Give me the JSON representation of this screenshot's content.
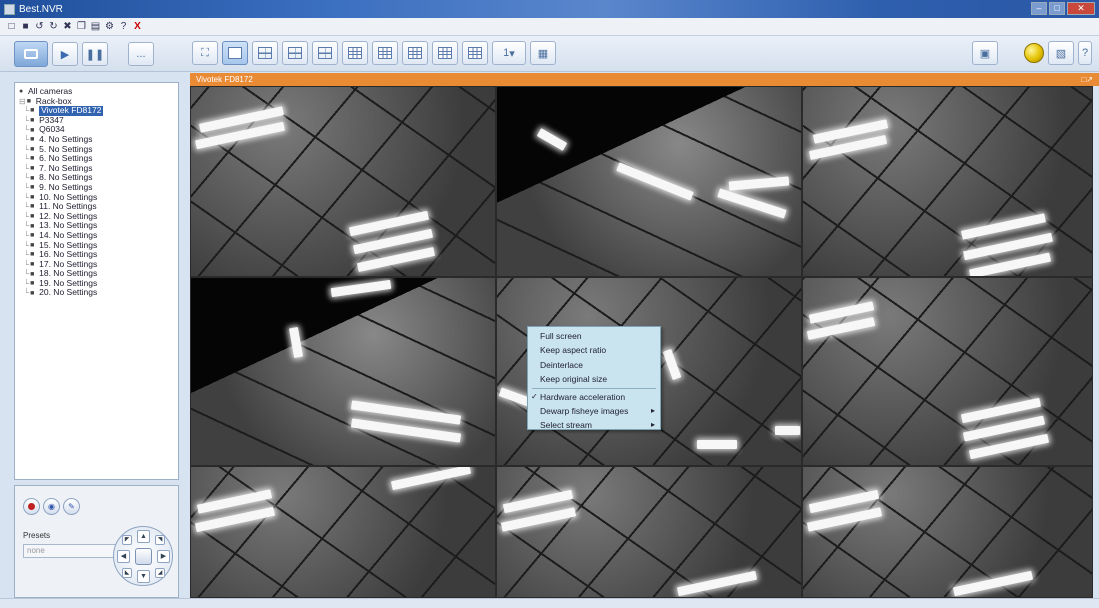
{
  "window": {
    "title": "Best.NVR"
  },
  "quickbar": {
    "icons": [
      "new-icon",
      "open-icon",
      "undo-icon",
      "redo-icon",
      "cut-icon",
      "copy-icon",
      "paste-icon",
      "settings-icon",
      "help-icon",
      "exit-icon"
    ],
    "exit_label": "X"
  },
  "toolbar": {
    "left_buttons": [
      "live-view-icon",
      "play-icon",
      "pause-icon"
    ],
    "dots_label": "...",
    "page_select": "1"
  },
  "tree": {
    "root": "All cameras",
    "group": "Rack-box",
    "items": [
      {
        "label": "Vivotek FD8172",
        "selected": true
      },
      {
        "label": "P3347",
        "selected": false
      },
      {
        "label": "Q6034",
        "selected": false
      },
      {
        "label": "4. No Settings",
        "selected": false
      },
      {
        "label": "5. No Settings",
        "selected": false
      },
      {
        "label": "6. No Settings",
        "selected": false
      },
      {
        "label": "7. No Settings",
        "selected": false
      },
      {
        "label": "8. No Settings",
        "selected": false
      },
      {
        "label": "9. No Settings",
        "selected": false
      },
      {
        "label": "10. No Settings",
        "selected": false
      },
      {
        "label": "11. No Settings",
        "selected": false
      },
      {
        "label": "12. No Settings",
        "selected": false
      },
      {
        "label": "13. No Settings",
        "selected": false
      },
      {
        "label": "14. No Settings",
        "selected": false
      },
      {
        "label": "15. No Settings",
        "selected": false
      },
      {
        "label": "16. No Settings",
        "selected": false
      },
      {
        "label": "17. No Settings",
        "selected": false
      },
      {
        "label": "18. No Settings",
        "selected": false
      },
      {
        "label": "19. No Settings",
        "selected": false
      },
      {
        "label": "20. No Settings",
        "selected": false
      }
    ]
  },
  "ptz": {
    "presets_label": "Presets",
    "presets_value": "none"
  },
  "video": {
    "header_title": "Vivotek FD8172"
  },
  "context_menu": {
    "items": [
      {
        "label": "Full screen",
        "checked": false,
        "submenu": false
      },
      {
        "label": "Keep aspect ratio",
        "checked": false,
        "submenu": false
      },
      {
        "label": "Deinterlace",
        "checked": false,
        "submenu": false
      },
      {
        "label": "Keep original size",
        "checked": false,
        "submenu": false
      },
      {
        "label": "Hardware acceleration",
        "checked": true,
        "submenu": false
      },
      {
        "label": "Dewarp fisheye images",
        "checked": false,
        "submenu": true
      },
      {
        "label": "Select stream",
        "checked": false,
        "submenu": true
      }
    ]
  }
}
